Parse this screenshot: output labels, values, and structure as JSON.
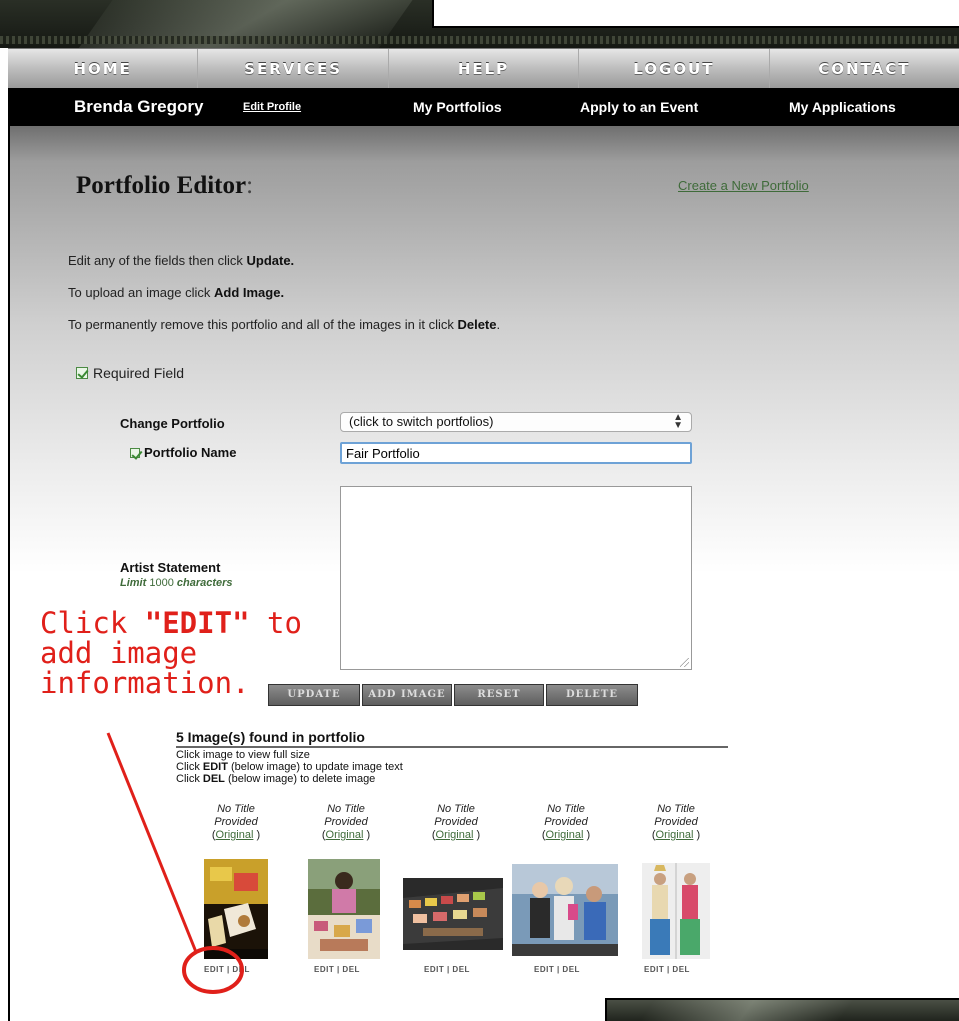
{
  "nav": {
    "items": [
      "HOME",
      "SERVICES",
      "HELP",
      "LOGOUT",
      "CONTACT"
    ]
  },
  "userbar": {
    "name": "Brenda Gregory",
    "edit_profile": "Edit Profile",
    "my_portfolios": "My Portfolios",
    "apply_event": "Apply to an Event",
    "my_applications": "My Applications"
  },
  "page": {
    "title": "Portfolio Editor",
    "title_colon": ":",
    "create_link": "Create a New Portfolio"
  },
  "instructions": {
    "line1_pre": "Edit any of the fields then click ",
    "line1_bold": "Update.",
    "line2_pre": "To upload an image click ",
    "line2_bold": "Add Image.",
    "line3_pre": "To permanently remove this portfolio and all of the images in it click ",
    "line3_bold": "Delete",
    "line3_post": ".",
    "required": "Required Field"
  },
  "form": {
    "change_portfolio_label": "Change Portfolio",
    "change_portfolio_value": "(click to switch portfolios)",
    "portfolio_name_label": "Portfolio Name",
    "portfolio_name_value": "Fair Portfolio",
    "artist_statement_label": "Artist Statement",
    "limit_pre": "Limit ",
    "limit_num": "1000",
    "limit_post": " characters",
    "artist_statement_value": ""
  },
  "buttons": {
    "update": "UPDATE",
    "add_image": "ADD IMAGE",
    "reset": "RESET",
    "delete": "DELETE"
  },
  "annotation": {
    "line1_pre": "Click ",
    "line1_bold": "\"EDIT\"",
    "line1_post": " to",
    "line2": "add image",
    "line3": "information."
  },
  "images": {
    "header": "5 Image(s) found in portfolio",
    "help1": "Click image to view full size",
    "help2_pre": "Click ",
    "help2_bold": "EDIT",
    "help2_post": " (below image) to update image text",
    "help3_pre": "Click ",
    "help3_bold": "DEL",
    "help3_post": " (below image) to delete image",
    "items": [
      {
        "title1": "No Title",
        "title2": "Provided",
        "orig": "Original",
        "edit": "EDIT",
        "sep": " | ",
        "del": "DEL"
      },
      {
        "title1": "No Title",
        "title2": "Provided",
        "orig": "Original",
        "edit": "EDIT",
        "sep": " | ",
        "del": "DEL"
      },
      {
        "title1": "No Title",
        "title2": "Provided",
        "orig": "Original",
        "edit": "EDIT",
        "sep": " | ",
        "del": "DEL"
      },
      {
        "title1": "No Title",
        "title2": "Provided",
        "orig": "Original",
        "edit": "EDIT",
        "sep": " | ",
        "del": "DEL"
      },
      {
        "title1": "No Title",
        "title2": "Provided",
        "orig": "Original",
        "edit": "EDIT",
        "sep": " | ",
        "del": "DEL"
      }
    ]
  },
  "colors": {
    "accent_green": "#3f6b3a",
    "annotation_red": "#e0201a",
    "nav_black": "#000000",
    "input_focus": "#6ea2d6"
  }
}
